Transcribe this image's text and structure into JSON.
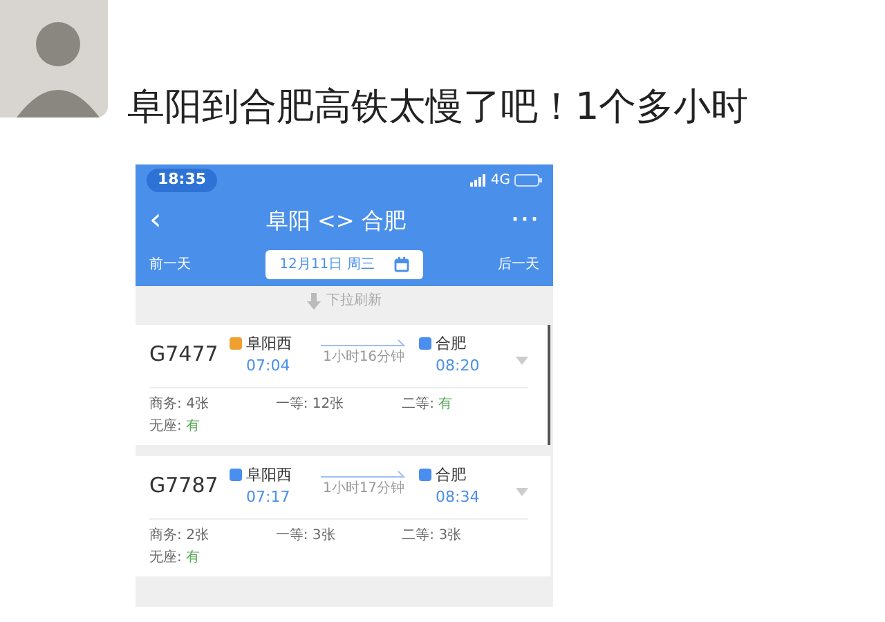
{
  "post": {
    "text": "阜阳到合肥高铁太慢了吧！1个多小时"
  },
  "phone": {
    "status_bar": {
      "time": "18:35",
      "network": "4G"
    },
    "nav": {
      "back": "‹",
      "title": "阜阳 <> 合肥",
      "more": "···"
    },
    "date_bar": {
      "prev": "前一天",
      "date": "12月11日 周三",
      "next": "后一天"
    },
    "refresh_hint": "下拉刷新",
    "trains": [
      {
        "number": "G7477",
        "from": {
          "name": "阜阳西",
          "time": "07:04",
          "color": "#f0a030"
        },
        "duration": "1小时16分钟",
        "to": {
          "name": "合肥",
          "time": "08:20",
          "color": "#4a8ef0"
        },
        "seats": [
          {
            "label": "商务:",
            "value": "4张",
            "kind": "count"
          },
          {
            "label": "一等:",
            "value": "12张",
            "kind": "count"
          },
          {
            "label": "二等:",
            "value": "有",
            "kind": "plenty"
          },
          {
            "label": "无座:",
            "value": "有",
            "kind": "plenty"
          }
        ]
      },
      {
        "number": "G7787",
        "from": {
          "name": "阜阳西",
          "time": "07:17",
          "color": "#4a8ef0"
        },
        "duration": "1小时17分钟",
        "to": {
          "name": "合肥",
          "time": "08:34",
          "color": "#4a8ef0"
        },
        "seats": [
          {
            "label": "商务:",
            "value": "2张",
            "kind": "count"
          },
          {
            "label": "一等:",
            "value": "3张",
            "kind": "count"
          },
          {
            "label": "二等:",
            "value": "3张",
            "kind": "count"
          },
          {
            "label": "无座:",
            "value": "有",
            "kind": "plenty"
          }
        ]
      }
    ]
  }
}
